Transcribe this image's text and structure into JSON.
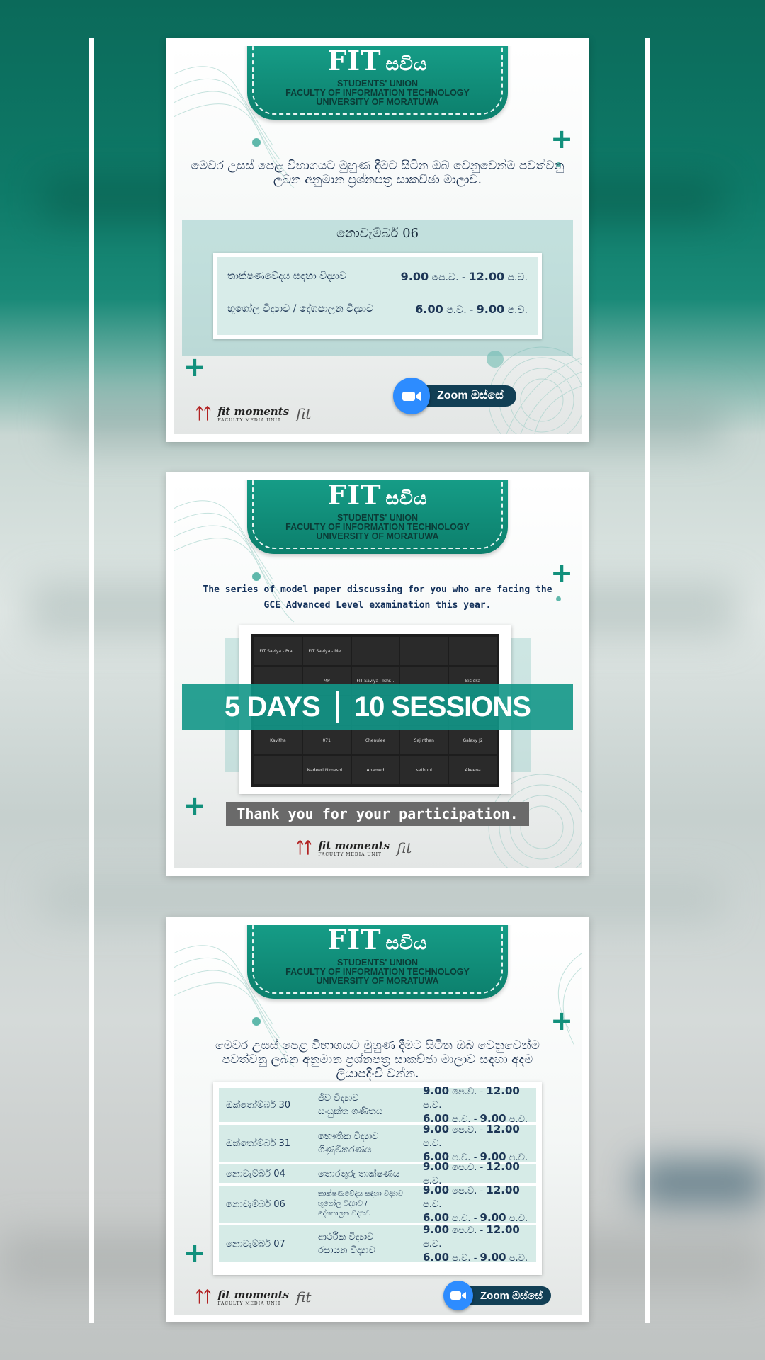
{
  "colors": {
    "teal": "#12907c",
    "dark_teal": "#0c7f6c",
    "navy": "#1d3656",
    "zoom_blue": "#2d8cff"
  },
  "header": {
    "brand": "FIT",
    "brand_sinhala": "සවිය",
    "line1": "STUDENTS' UNION",
    "line2": "FACULTY OF INFORMATION TECHNOLOGY",
    "line3": "UNIVERSITY OF MORATUWA"
  },
  "poster1": {
    "intro": "මෙවර උසස් පෙළ විභාගයට මුහුණ දීමට සිටින ඔබ වෙනුවෙන්ම පවත්වනු ලබන අනුමාන ප්‍රශ්නපත්‍ර සාකච්ඡා මාලාව.",
    "date": "නොවැම්බර් 06",
    "rows": [
      {
        "subject": "තාක්ෂණවේදය සඳහා විද්‍යාව",
        "start": "9.00",
        "start_unit": "පෙ.ව.",
        "end": "12.00",
        "end_unit": "ප.ව."
      },
      {
        "subject": "භූගෝල විද්‍යාව / දේශපාලන විද්‍යාව",
        "start": "6.00",
        "start_unit": "ප.ව.",
        "end": "9.00",
        "end_unit": "ප.ව."
      }
    ],
    "zoom_label": "Zoom ඔස්සේ"
  },
  "poster2": {
    "caption_line1": "The series of model paper discussing for you who are facing the",
    "caption_line2": "GCE Advanced Level examination this year.",
    "banner_left": "5 DAYS",
    "banner_right": "10 SESSIONS",
    "thanks": "Thank you for your participation.",
    "tiles": [
      "FIT Saviya - Pra...",
      "FIT Saviya - Me...",
      "",
      "",
      "",
      "",
      "MP",
      "FIT Saviya - Ishr...",
      "",
      "Bisleka",
      "",
      "",
      "",
      "",
      "",
      "Kavitha",
      "071",
      "Chenulee",
      "Sajinthan",
      "Galaxy J2",
      "",
      "Nadeeri Nimeshi...",
      "Ahamed",
      "sethuni",
      "Akeena"
    ]
  },
  "poster3": {
    "intro": "මෙවර උසස් පෙළ විභාගයට මුහුණ දීමට සිටින ඔබ වෙනුවෙන්ම පවත්වනු ලබන අනුමාන ප්‍රශ්නපත්‍ර සාකච්ඡා මාලාව සඳහා අදම ලියාපදිංචි වන්න.",
    "rows": [
      {
        "date": "ඔක්තෝම්බර් 30",
        "subjects": [
          "ජීව විද්‍යාව",
          "සංයුක්ත ගණිතය"
        ],
        "times": [
          [
            "9.00",
            "පෙ.ව. -",
            "12.00",
            "ප.ව."
          ],
          [
            "6.00",
            "ප.ව. -",
            "9.00",
            "ප.ව."
          ]
        ]
      },
      {
        "date": "ඔක්තෝම්බර් 31",
        "subjects": [
          "භෞතික විද්‍යාව",
          "ගිණුම්කරණය"
        ],
        "times": [
          [
            "9.00",
            "පෙ.ව. -",
            "12.00",
            "ප.ව."
          ],
          [
            "6.00",
            "ප.ව. -",
            "9.00",
            "ප.ව."
          ]
        ]
      },
      {
        "date": "නොවැම්බර් 04",
        "subjects": [
          "තොරතුරු තාක්ෂණය"
        ],
        "times": [
          [
            "9.00",
            "පෙ.ව. -",
            "12.00",
            "ප.ව."
          ]
        ]
      },
      {
        "date": "නොවැම්බර් 06",
        "subjects": [
          "තාක්ෂණවේදය සඳහා විද්‍යාව",
          "භූගෝල විද්‍යාව /",
          "දේශපාලන විද්‍යාව"
        ],
        "times": [
          [
            "9.00",
            "පෙ.ව. -",
            "12.00",
            "ප.ව."
          ],
          [
            "6.00",
            "ප.ව. -",
            "9.00",
            "ප.ව."
          ]
        ]
      },
      {
        "date": "නොවැම්බර් 07",
        "subjects": [
          "ආර්ථික විද්‍යාව",
          "රසායන විද්‍යාව"
        ],
        "times": [
          [
            "9.00",
            "පෙ.ව. -",
            "12.00",
            "ප.ව."
          ],
          [
            "6.00",
            "ප.ව. -",
            "9.00",
            "ප.ව."
          ]
        ]
      }
    ],
    "zoom_label": "Zoom ඔස්සේ"
  },
  "logos": {
    "fit_moments": "fit moments",
    "fit_moments_sub": "FACULTY MEDIA UNIT",
    "fit_research": "fit"
  }
}
